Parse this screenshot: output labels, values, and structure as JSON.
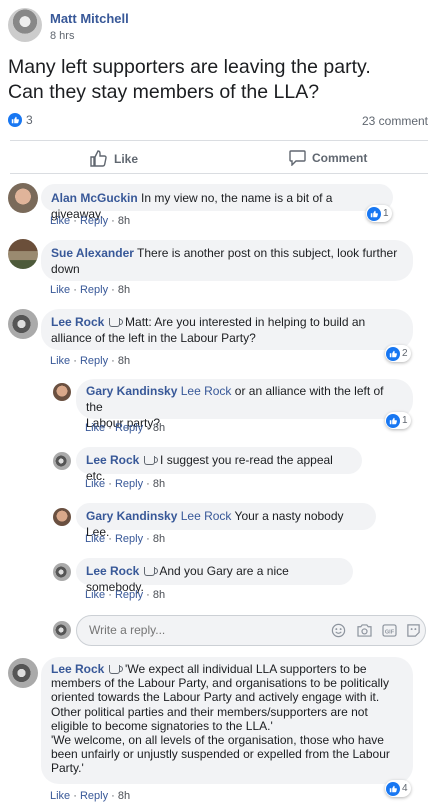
{
  "post": {
    "author": "Matt Mitchell",
    "time": "8 hrs",
    "text_line1": "Many left supporters are leaving the party.",
    "text_line2": "Can they stay members of the LLA?",
    "reactions": "3",
    "comments": "23 comment"
  },
  "actions": {
    "like": "Like",
    "comment": "Comment",
    "reply": "Reply"
  },
  "comments": [
    {
      "name": "Alan McGuckin",
      "text": "In my view no, the name is a bit of a giveaway.",
      "time": "8h",
      "reactions": "1"
    },
    {
      "name": "Sue Alexander",
      "text1": "There is another post on this subject, look further",
      "text2": "down",
      "time": "8h"
    },
    {
      "name": "Lee Rock",
      "text1": "Matt: Are you interested in helping to build an",
      "text2": "alliance of the left in the Labour Party?",
      "time": "8h",
      "reactions": "2"
    },
    {
      "name": "Gary Kandinsky",
      "mention": "Lee Rock",
      "text1": "or an alliance with the left of the",
      "text2": "Labour party?",
      "time": "8h",
      "reactions": "1"
    },
    {
      "name": "Lee Rock",
      "text": "I suggest you re-read the appeal etc.",
      "time": "8h"
    },
    {
      "name": "Gary Kandinsky",
      "mention": "Lee Rock",
      "text": "Your a nasty nobody Lee.",
      "time": "8h"
    },
    {
      "name": "Lee Rock",
      "text": "And you Gary are a nice somebody.",
      "time": "8h"
    },
    {
      "name": "Lee Rock",
      "l1": "'We expect all individual LLA supporters to be",
      "l2": "members of the Labour Party, and organisations to be politically",
      "l3": "oriented towards the Labour Party and actively engage with it.",
      "l4": "Other political parties and their members/supporters are not",
      "l5": "eligible to become signatories to the LLA.'",
      "l6": "'We welcome, on all levels of the organisation, those who have",
      "l7": "been unfairly or unjustly suspended or expelled from the Labour",
      "l8": "Party.'",
      "time": "8h",
      "reactions": "4"
    }
  ],
  "reply_box": {
    "placeholder": "Write a reply..."
  }
}
